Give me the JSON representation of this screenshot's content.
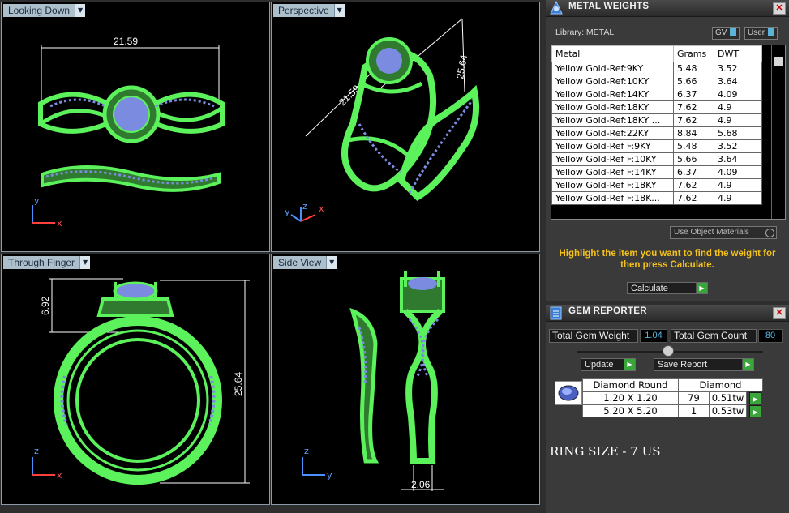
{
  "viewports": {
    "looking_down": {
      "label": "Looking Down",
      "dimension": "21.59",
      "axes": {
        "v": "y",
        "h": "x"
      }
    },
    "perspective": {
      "label": "Perspective",
      "dimension_a": "21.59",
      "dimension_b": "25.64",
      "axes": {
        "a": "y",
        "b": "z",
        "c": "x"
      }
    },
    "through_finger": {
      "label": "Through Finger",
      "dimension_a": "6.92",
      "dimension_b": "25.64",
      "axes": {
        "v": "z",
        "h": "x"
      }
    },
    "side_view": {
      "label": "Side View",
      "dimension": "2.06",
      "axes": {
        "v": "z",
        "h": "y"
      }
    }
  },
  "metal_weights": {
    "title": "METAL WEIGHTS",
    "library_label": "Library: METAL",
    "gv_label": "GV",
    "user_label": "User",
    "columns": [
      "Metal",
      "Grams",
      "DWT"
    ],
    "rows": [
      {
        "metal": "Yellow Gold-Ref:9KY",
        "grams": "5.48",
        "dwt": "3.52"
      },
      {
        "metal": "Yellow Gold-Ref:10KY",
        "grams": "5.66",
        "dwt": "3.64"
      },
      {
        "metal": "Yellow Gold-Ref:14KY",
        "grams": "6.37",
        "dwt": "4.09"
      },
      {
        "metal": "Yellow Gold-Ref:18KY",
        "grams": "7.62",
        "dwt": "4.9"
      },
      {
        "metal": "Yellow Gold-Ref:18KY ...",
        "grams": "7.62",
        "dwt": "4.9"
      },
      {
        "metal": "Yellow Gold-Ref:22KY",
        "grams": "8.84",
        "dwt": "5.68"
      },
      {
        "metal": "Yellow Gold-Ref F:9KY",
        "grams": "5.48",
        "dwt": "3.52"
      },
      {
        "metal": "Yellow Gold-Ref F:10KY",
        "grams": "5.66",
        "dwt": "3.64"
      },
      {
        "metal": "Yellow Gold-Ref F:14KY",
        "grams": "6.37",
        "dwt": "4.09"
      },
      {
        "metal": "Yellow Gold-Ref F:18KY",
        "grams": "7.62",
        "dwt": "4.9"
      },
      {
        "metal": "Yellow Gold-Ref F:18K...",
        "grams": "7.62",
        "dwt": "4.9"
      }
    ],
    "use_object_materials": "Use Object Materials",
    "hint": "Highlight the item you want to find the weight for then press Calculate.",
    "calculate_label": "Calculate"
  },
  "gem_reporter": {
    "title": "GEM REPORTER",
    "total_weight_label": "Total Gem Weight",
    "total_weight_value": "1.04",
    "total_count_label": "Total Gem Count",
    "total_count_value": "80",
    "update_label": "Update",
    "save_report_label": "Save Report",
    "columns": [
      "Diamond Round",
      "Diamond"
    ],
    "rows": [
      {
        "size": "1.20 X 1.20",
        "count": "79",
        "weight": "0.51tw"
      },
      {
        "size": "5.20 X 5.20",
        "count": "1",
        "weight": "0.53tw"
      }
    ]
  },
  "ring_size": "RING SIZE - 7 US",
  "colors": {
    "wire": "#5cf25c",
    "gem": "#7b8ce0",
    "accent": "#f3c11a",
    "value": "#5ab9e6"
  }
}
